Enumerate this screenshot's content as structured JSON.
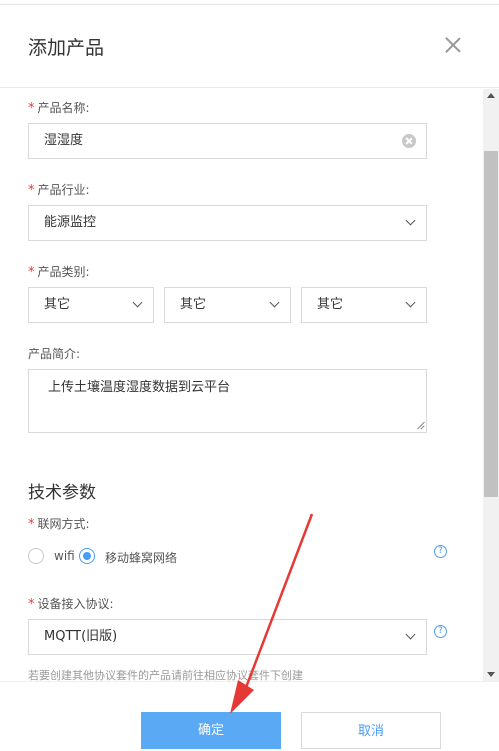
{
  "dialog": {
    "title": "添加产品"
  },
  "fields": {
    "product_name": {
      "label": "产品名称:",
      "value": "湿湿度"
    },
    "industry": {
      "label": "产品行业:",
      "value": "能源监控"
    },
    "category": {
      "label": "产品类别:",
      "values": [
        "其它",
        "其它",
        "其它"
      ]
    },
    "description": {
      "label": "产品简介:",
      "value": "上传土壤温度湿度数据到云平台"
    }
  },
  "tech": {
    "section_title": "技术参数",
    "network": {
      "label": "联网方式:",
      "options": [
        "wifi",
        "移动蜂窝网络"
      ],
      "selected": "移动蜂窝网络"
    },
    "protocol": {
      "label": "设备接入协议:",
      "value": "MQTT(旧版)"
    },
    "hint": "若要创建其他协议套件的产品请前往相应协议套件下创建"
  },
  "footer": {
    "confirm_label": "确定",
    "cancel_label": "取消"
  },
  "icons": {
    "help": "?",
    "required_mark": "*"
  },
  "colors": {
    "primary": "#5aa9f5",
    "link": "#4a9cf3",
    "required": "#e33333",
    "arrow": "#e53935"
  }
}
